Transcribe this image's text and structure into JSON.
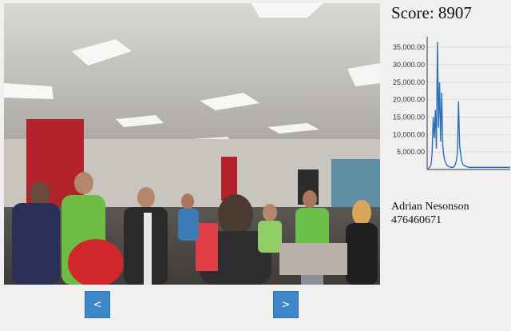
{
  "photo": {
    "kind": "crowded office room with people"
  },
  "nav": {
    "prev_label": "<",
    "next_label": ">"
  },
  "score": {
    "text": "Score: 8907"
  },
  "player": {
    "name": "Adrian Nesonson",
    "id": "476460671"
  },
  "chart_data": {
    "type": "line",
    "title": "",
    "xlabel": "",
    "ylabel": "",
    "ylim": [
      0,
      38000
    ],
    "y_ticks": [
      5000,
      10000,
      15000,
      20000,
      25000,
      30000,
      35000
    ],
    "y_tick_labels": [
      "5,000.00",
      "10,000.00",
      "15,000.00",
      "20,000.00",
      "25,000.00",
      "30,000.00",
      "35,000.00"
    ],
    "grid": true,
    "color": "#2b6fb5",
    "series": [
      {
        "values": [
          0,
          400,
          800,
          1500,
          5000,
          15000,
          9000,
          17000,
          6000,
          36500,
          12000,
          25000,
          8000,
          22000,
          7000,
          4000,
          2500,
          1800,
          1200,
          1000,
          800,
          700,
          600,
          600,
          700,
          900,
          1500,
          2500,
          5000,
          19500,
          7000,
          4500,
          2500,
          1600,
          1200,
          1000,
          900,
          800,
          700,
          600,
          600,
          600,
          600,
          600,
          600,
          600,
          600,
          600,
          600,
          600,
          600,
          600,
          600,
          600,
          600,
          600,
          600,
          600,
          600,
          600,
          600,
          600,
          600,
          600,
          600,
          600,
          600,
          600,
          600,
          600,
          600,
          600,
          600,
          600,
          600,
          600,
          600,
          600,
          600
        ]
      }
    ]
  }
}
